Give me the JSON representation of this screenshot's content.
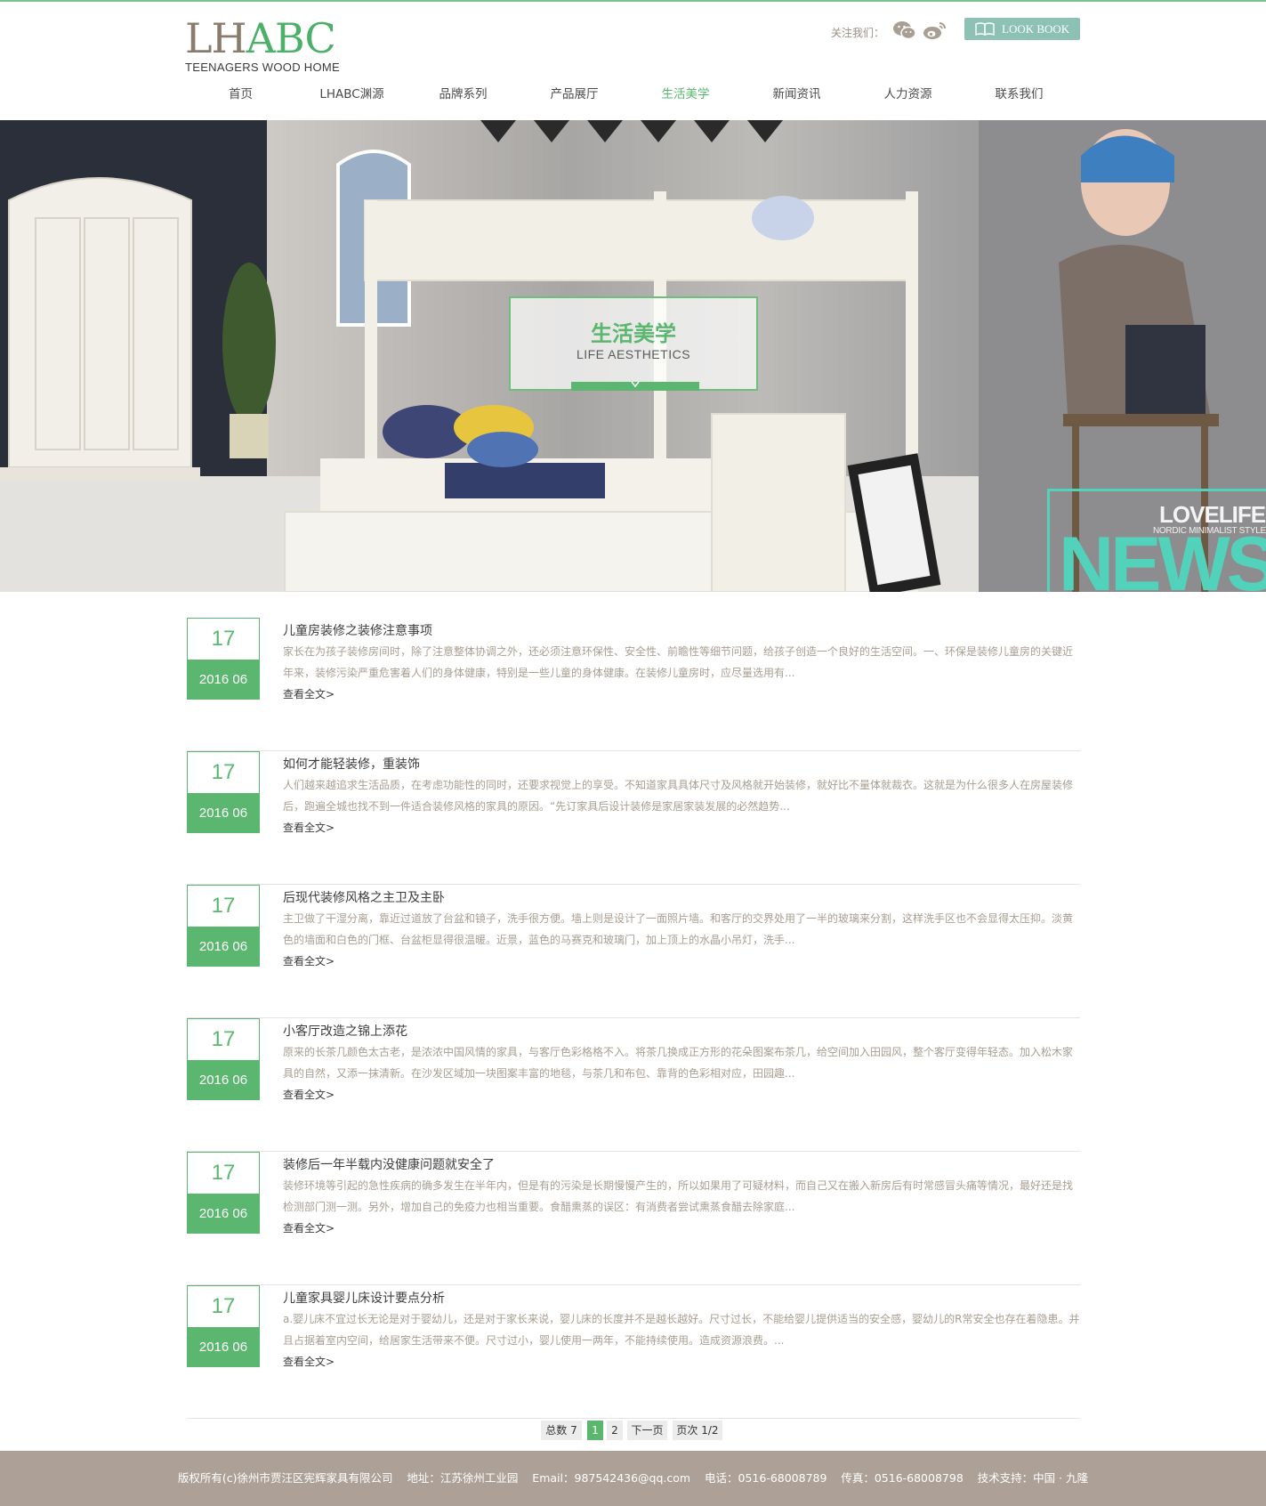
{
  "brand": {
    "logo_letters_1": "LH",
    "logo_letters_2": "ABC",
    "tagline": "TEENAGERS WOOD HOME"
  },
  "header": {
    "follow_label": "关注我们：",
    "lookbook_label": "LOOK BOOK",
    "icons": [
      "wechat-icon",
      "weibo-icon",
      "book-icon"
    ]
  },
  "nav": {
    "items": [
      "首页",
      "LHABC渊源",
      "品牌系列",
      "产品展厅",
      "生活美学",
      "新闻资讯",
      "人力资源",
      "联系我们"
    ],
    "active_index": 4
  },
  "banner": {
    "title_cn": "生活美学",
    "title_en": "LIFE AESTHETICS",
    "love": "LOVELIFE",
    "nordic": "NORDIC MINIMALIST STYLE",
    "news": "NEWS"
  },
  "articles": [
    {
      "day": "17",
      "ym": "2016 06",
      "title": "儿童房装修之装修注意事项",
      "desc": "家长在为孩子装修房间时，除了注意整体协调之外，还必须注意环保性、安全性、前瞻性等细节问题，给孩子创造一个良好的生活空间。一、环保是装修儿童房的关键近年来，装修污染严重危害着人们的身体健康，特别是一些儿童的身体健康。在装修儿童房时，应尽量选用有...",
      "more": "查看全文>"
    },
    {
      "day": "17",
      "ym": "2016 06",
      "title": "如何才能轻装修，重装饰",
      "desc": "人们越来越追求生活品质，在考虑功能性的同时，还要求视觉上的享受。不知道家具具体尺寸及风格就开始装修，就好比不量体就裁衣。这就是为什么很多人在房屋装修后，跑遍全城也找不到一件适合装修风格的家具的原因。“先订家具后设计装修是家居家装发展的必然趋势...",
      "more": "查看全文>"
    },
    {
      "day": "17",
      "ym": "2016 06",
      "title": "后现代装修风格之主卫及主卧",
      "desc": "主卫做了干湿分离，靠近过道放了台盆和镜子，洗手很方便。墙上则是设计了一面照片墙。和客厅的交界处用了一半的玻璃来分割，这样洗手区也不会显得太压抑。淡黄色的墙面和白色的门框、台盆柜显得很温暖。近景，蓝色的马赛克和玻璃门，加上顶上的水晶小吊灯，洗手...",
      "more": "查看全文>"
    },
    {
      "day": "17",
      "ym": "2016 06",
      "title": "小客厅改造之锦上添花",
      "desc": "原来的长茶几颜色太古老，是浓浓中国风情的家具，与客厅色彩格格不入。将茶几换成正方形的花朵图案布茶几，给空间加入田园风，整个客厅变得年轻态。加入松木家具的自然，又添一抹清新。在沙发区域加一块图案丰富的地毯，与茶几和布包、靠背的色彩相对应，田园趣...",
      "more": "查看全文>"
    },
    {
      "day": "17",
      "ym": "2016 06",
      "title": "装修后一年半载内没健康问题就安全了",
      "desc": "装修环境等引起的急性疾病的确多发生在半年内，但是有的污染是长期慢慢产生的，所以如果用了可疑材料，而自己又在搬入新房后有时常感冒头痛等情况，最好还是找检测部门测一测。另外，增加自己的免疫力也相当重要。食醋熏蒸的误区：有消费者尝试熏蒸食醋去除家庭...",
      "more": "查看全文>"
    },
    {
      "day": "17",
      "ym": "2016 06",
      "title": "儿童家具婴儿床设计要点分析",
      "desc": "a.婴儿床不宜过长无论是对于婴幼儿，还是对于家长来说，婴儿床的长度并不是越长越好。尺寸过长，不能给婴儿提供适当的安全感，婴幼儿的R常安全也存在着隐患。并且占据着室内空间，给居家生活带来不便。尺寸过小，婴儿使用一两年，不能持续使用。造成资源浪费。...",
      "more": "查看全文>"
    }
  ],
  "pager": {
    "total": "总数 7",
    "pages": [
      "1",
      "2"
    ],
    "active": "1",
    "next": "下一页",
    "info": "页次 1/2"
  },
  "footer": {
    "text": "版权所有(c)徐州市贾汪区宪辉家具有限公司    地址：江苏徐州工业园    Email：987542436@qq.com    电话：0516-68008789    传真：0516-68008798    技术支持：中国 · 九隆"
  },
  "colors": {
    "accent": "#5bb76f",
    "lookbook": "#8cc1b4",
    "news_teal": "#53d2bb",
    "footer": "#ada197"
  }
}
